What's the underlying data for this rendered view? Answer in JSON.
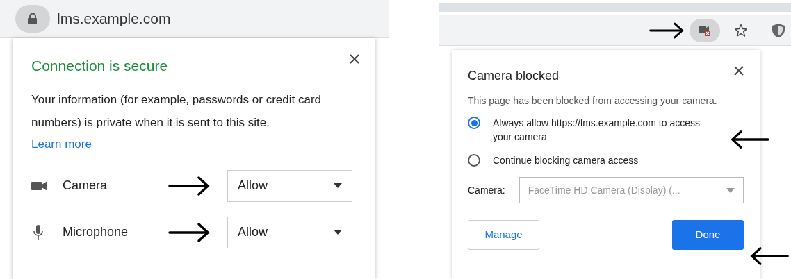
{
  "left": {
    "address_bar": {
      "url": "lms.example.com"
    },
    "popup": {
      "title": "Connection is secure",
      "description": "Your information (for example, passwords or credit card numbers) is private when it is sent to this site.",
      "link": "Learn more",
      "permissions": [
        {
          "kind": "camera",
          "label": "Camera",
          "value": "Allow"
        },
        {
          "kind": "microphone",
          "label": "Microphone",
          "value": "Allow"
        }
      ]
    }
  },
  "right": {
    "popup": {
      "title": "Camera blocked",
      "description": "This page has been blocked from accessing your camera.",
      "options": [
        {
          "label": "Always allow https://lms.example.com to access your camera",
          "selected": true
        },
        {
          "label": "Continue blocking camera access",
          "selected": false
        }
      ],
      "camera_field": {
        "label": "Camera:",
        "value": "FaceTime HD Camera (Display) (..."
      },
      "buttons": [
        {
          "kind": "secondary",
          "label": "Manage"
        },
        {
          "kind": "primary",
          "label": "Done"
        }
      ]
    }
  }
}
